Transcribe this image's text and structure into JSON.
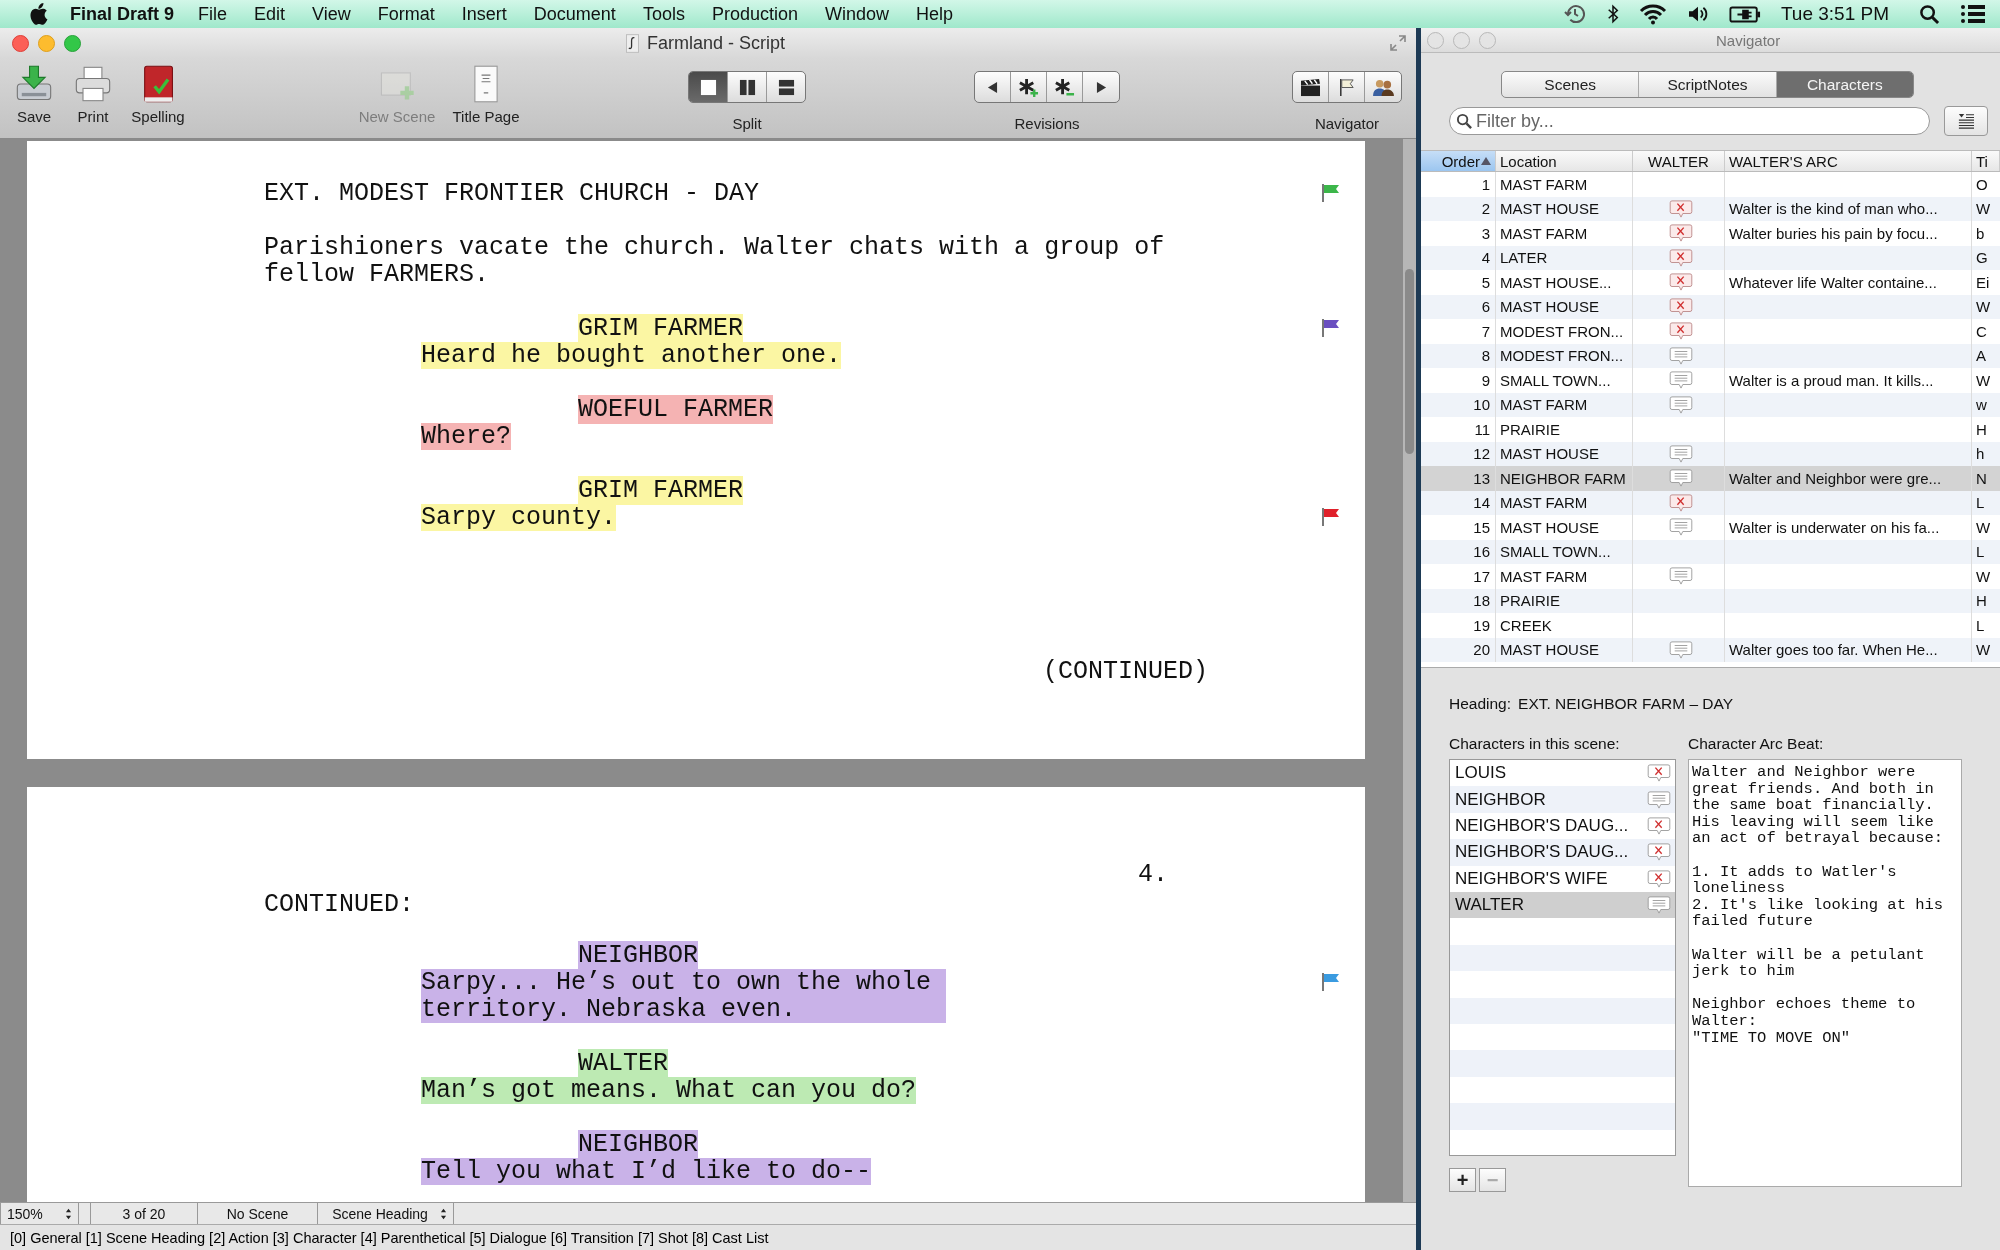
{
  "menubar": {
    "app": "Final Draft 9",
    "menus": [
      "File",
      "Edit",
      "View",
      "Format",
      "Insert",
      "Document",
      "Tools",
      "Production",
      "Window",
      "Help"
    ],
    "clock": "Tue 3:51 PM"
  },
  "window": {
    "title": "Farmland - Script"
  },
  "toolbar": [
    {
      "kind": "button",
      "label": "Save",
      "disabled": false
    },
    {
      "kind": "button",
      "label": "Print",
      "disabled": false
    },
    {
      "kind": "button",
      "label": "Spelling",
      "disabled": false
    },
    {
      "kind": "button",
      "label": "New Scene",
      "disabled": true
    },
    {
      "kind": "button",
      "label": "Title Page",
      "disabled": false
    },
    {
      "kind": "segmented",
      "label": "Split",
      "segments": [
        {
          "selected": true
        },
        {
          "selected": false
        },
        {
          "selected": false
        }
      ]
    },
    {
      "kind": "segmented",
      "label": "Revisions",
      "segments": [
        {
          "selected": false
        },
        {
          "selected": false
        },
        {
          "selected": false
        },
        {
          "selected": false
        }
      ]
    },
    {
      "kind": "segmented",
      "label": "Navigator",
      "segments": [
        {
          "selected": false
        },
        {
          "selected": false
        },
        {
          "selected": false
        }
      ]
    }
  ],
  "pages": [
    {
      "blocks": [
        {
          "kind": "heading",
          "text": "EXT. MODEST FRONTIER CHURCH - DAY",
          "flag": {
            "color": "#3cb64a"
          }
        },
        {
          "kind": "action",
          "text": "Parishioners vacate the church. Walter chats with a group of fellow FARMERS."
        },
        {
          "kind": "character",
          "text": "GRIM FARMER",
          "color": "#fbf6a3",
          "flag": {
            "color": "#6a4fc0"
          }
        },
        {
          "kind": "dialogue",
          "text": "Heard he bought another one.",
          "color": "#fbf6a3"
        },
        {
          "kind": "character",
          "text": "WOEFUL FARMER",
          "color": "#f5b3b3"
        },
        {
          "kind": "dialogue",
          "text": "Where?",
          "color": "#f5b3b3"
        },
        {
          "kind": "character",
          "text": "GRIM FARMER",
          "color": "#fbf6a3"
        },
        {
          "kind": "dialogue",
          "text": "Sarpy county.",
          "color": "#fbf6a3",
          "flag": {
            "color": "#e0202a"
          }
        },
        {
          "kind": "more",
          "text": "(CONTINUED)"
        }
      ]
    },
    {
      "blocks": [
        {
          "kind": "page-number",
          "text": "4."
        },
        {
          "kind": "continued",
          "text": "CONTINUED:"
        },
        {
          "kind": "character",
          "text": "NEIGHBOR",
          "color": "#c9b2e8"
        },
        {
          "kind": "dialogue",
          "text": "Sarpy... He’s out to own the whole territory. Nebraska even.",
          "color": "#c9b2e8",
          "flag": {
            "color": "#3a9be0"
          }
        },
        {
          "kind": "character",
          "text": "WALTER",
          "color": "#bdeab3"
        },
        {
          "kind": "dialogue",
          "text": "Man’s got means. What can you do?",
          "color": "#bdeab3"
        },
        {
          "kind": "character",
          "text": "NEIGHBOR",
          "color": "#c9b2e8"
        },
        {
          "kind": "dialogue",
          "text": "Tell you what I’d like to do--",
          "color": "#c9b2e8"
        }
      ]
    }
  ],
  "status": {
    "zoom": "150%",
    "page": "3 of 20",
    "scene": "No Scene",
    "element": "Scene Heading",
    "shortcuts": "[0] General [1] Scene Heading [2] Action [3] Character [4] Parenthetical [5] Dialogue [6] Transition [7] Shot [8] Cast List"
  },
  "navigator": {
    "title": "Navigator",
    "tabs": [
      {
        "label": "Scenes",
        "selected": false
      },
      {
        "label": "ScriptNotes",
        "selected": false
      },
      {
        "label": "Characters",
        "selected": true
      }
    ],
    "filter_placeholder": "Filter by...",
    "columns": [
      {
        "label": "Order",
        "selected": true
      },
      {
        "label": "Location",
        "selected": false
      },
      {
        "label": "WALTER",
        "selected": false
      },
      {
        "label": "WALTER'S ARC",
        "selected": false
      },
      {
        "label": "Ti",
        "selected": false
      }
    ],
    "rows": [
      {
        "order": "1",
        "location": "MAST FARM",
        "column_5": "O",
        "walter_present": false,
        "selected": false
      },
      {
        "order": "2",
        "location": "MAST HOUSE",
        "walter_present": true,
        "walter_speaks": false,
        "arc": "Walter is the kind of man who...",
        "column_5": "W",
        "selected": false
      },
      {
        "order": "3",
        "location": "MAST FARM",
        "walter_present": true,
        "walter_speaks": false,
        "arc": "Walter buries his pain by focu...",
        "column_5": "b",
        "selected": false
      },
      {
        "order": "4",
        "location": "LATER",
        "walter_present": true,
        "walter_speaks": false,
        "column_5": "G",
        "selected": false
      },
      {
        "order": "5",
        "location": "MAST HOUSE...",
        "walter_present": true,
        "walter_speaks": false,
        "arc": "Whatever life Walter containe...",
        "column_5": "Ei",
        "selected": false
      },
      {
        "order": "6",
        "location": "MAST HOUSE",
        "walter_present": true,
        "walter_speaks": false,
        "column_5": "W",
        "selected": false
      },
      {
        "order": "7",
        "location": "MODEST FRON...",
        "walter_present": true,
        "walter_speaks": false,
        "column_5": "C",
        "selected": false
      },
      {
        "order": "8",
        "location": "MODEST FRON...",
        "walter_present": true,
        "walter_speaks": true,
        "column_5": "A",
        "selected": false
      },
      {
        "order": "9",
        "location": "SMALL TOWN...",
        "walter_present": true,
        "walter_speaks": true,
        "arc": "Walter is a proud man. It kills...",
        "column_5": "W",
        "selected": false
      },
      {
        "order": "10",
        "location": "MAST FARM",
        "walter_present": true,
        "walter_speaks": true,
        "column_5": "w",
        "selected": false
      },
      {
        "order": "11",
        "location": "PRAIRIE",
        "walter_present": false,
        "column_5": "H",
        "selected": false
      },
      {
        "order": "12",
        "location": "MAST HOUSE",
        "walter_present": true,
        "walter_speaks": true,
        "column_5": "h",
        "selected": false
      },
      {
        "order": "13",
        "location": "NEIGHBOR FARM",
        "walter_present": true,
        "walter_speaks": true,
        "arc": "Walter and Neighbor were gre...",
        "column_5": "N",
        "selected": true
      },
      {
        "order": "14",
        "location": "MAST FARM",
        "walter_present": true,
        "walter_speaks": false,
        "column_5": "L",
        "selected": false
      },
      {
        "order": "15",
        "location": "MAST HOUSE",
        "walter_present": true,
        "walter_speaks": true,
        "arc": "Walter is underwater on his fa...",
        "column_5": "W",
        "selected": false
      },
      {
        "order": "16",
        "location": "SMALL TOWN...",
        "walter_present": false,
        "column_5": "L",
        "selected": false
      },
      {
        "order": "17",
        "location": "MAST FARM",
        "walter_present": true,
        "walter_speaks": true,
        "column_5": "W",
        "selected": false
      },
      {
        "order": "18",
        "location": "PRAIRIE",
        "walter_present": false,
        "column_5": "H",
        "selected": false
      },
      {
        "order": "19",
        "location": "CREEK",
        "walter_present": false,
        "column_5": "L",
        "selected": false
      },
      {
        "order": "20",
        "location": "MAST HOUSE",
        "walter_present": true,
        "walter_speaks": true,
        "arc": "Walter goes too far. When He...",
        "column_5": "W",
        "selected": false
      }
    ],
    "heading_label": "Heading:",
    "heading": "EXT. NEIGHBOR FARM – DAY",
    "characters_label": "Characters in this scene:",
    "characters": [
      {
        "name": "LOUIS",
        "speaks": false,
        "selected": false
      },
      {
        "name": "NEIGHBOR",
        "speaks": true,
        "selected": false
      },
      {
        "name": "NEIGHBOR'S DAUG...",
        "speaks": false,
        "selected": false
      },
      {
        "name": "NEIGHBOR'S DAUG...",
        "speaks": false,
        "selected": false
      },
      {
        "name": "NEIGHBOR'S WIFE",
        "speaks": false,
        "selected": false
      },
      {
        "name": "WALTER",
        "speaks": true,
        "selected": true
      }
    ],
    "add_button": {
      "label": "+",
      "disabled": false
    },
    "remove_button": {
      "label": "−",
      "disabled": true
    },
    "arc_label": "Character Arc Beat:",
    "arc_text": "Walter and Neighbor were\ngreat friends. And both in\nthe same boat financially.\nHis leaving will seem like\nan act of betrayal because:\n\n1. It adds to Watler's\nloneliness\n2. It's like looking at his\nfailed future\n\nWalter will be a petulant\njerk to him\n\nNeighbor echoes theme to\nWalter:\n\"TIME TO MOVE ON\""
  }
}
